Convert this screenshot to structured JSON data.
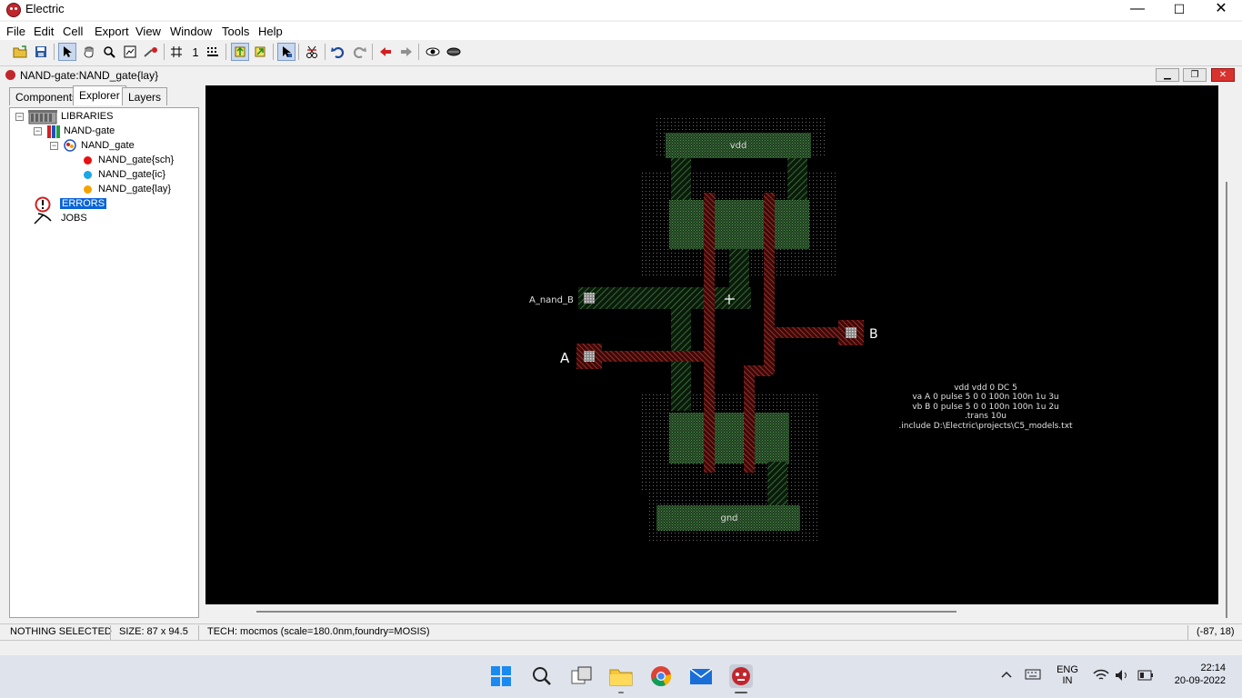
{
  "window": {
    "title": "Electric",
    "minimize_glyph": "—",
    "maximize_glyph": "☐",
    "close_glyph": "✕"
  },
  "menu": [
    "File",
    "Edit",
    "Cell",
    "Export",
    "View",
    "Window",
    "Tools",
    "Help"
  ],
  "toolbar": {
    "grid_number": "1",
    "icons": [
      "open-library-icon",
      "save-library-icon",
      "select-cursor-icon",
      "pan-hand-icon",
      "zoom-icon",
      "zoom-fit-icon",
      "measure-icon",
      "grid-icon",
      "align-grid-icon",
      "place-pin-icon",
      "place-export-icon",
      "select-special-icon",
      "cut-icon",
      "undo-icon",
      "redo-icon",
      "back-arrow-icon",
      "forward-arrow-icon",
      "eye-icon",
      "eye-hide-icon"
    ]
  },
  "document": {
    "title": "NAND-gate:NAND_gate{lay}"
  },
  "panel": {
    "tabs": [
      "Components",
      "Explorer",
      "Layers"
    ],
    "selected_tab": "Explorer",
    "tree": {
      "libraries": "LIBRARIES",
      "library": "NAND-gate",
      "cell": "NAND_gate",
      "views": [
        {
          "label": "NAND_gate{sch}",
          "color": "#e81010"
        },
        {
          "label": "NAND_gate{ic}",
          "color": "#1aa7e6"
        },
        {
          "label": "NAND_gate{lay}",
          "color": "#f5a300"
        }
      ],
      "errors": "ERRORS",
      "jobs": "JOBS"
    }
  },
  "layout": {
    "labels": {
      "vdd": "vdd",
      "gnd": "gnd",
      "output": "A_nand_B",
      "input_a": "A",
      "input_b": "B"
    },
    "spice": [
      "vdd vdd 0 DC 5",
      "va A 0 pulse 5 0 0 100n 100n 1u 3u",
      "vb B 0 pulse 5 0 0 100n 100n 1u 2u",
      ".trans 10u",
      ".include D:\\Electric\\projects\\C5_models.txt"
    ],
    "colors": {
      "metal": "#3c8a3c",
      "poly": "#c0392b",
      "background": "#000000"
    }
  },
  "status": {
    "selection": "NOTHING SELECTED",
    "size": "SIZE: 87 x 94.5",
    "tech": "TECH: mocmos (scale=180.0nm,foundry=MOSIS)",
    "coords": "(-87, 18)"
  },
  "taskbar": {
    "lang_top": "ENG",
    "lang_bottom": "IN",
    "time": "22:14",
    "date": "20-09-2022"
  }
}
